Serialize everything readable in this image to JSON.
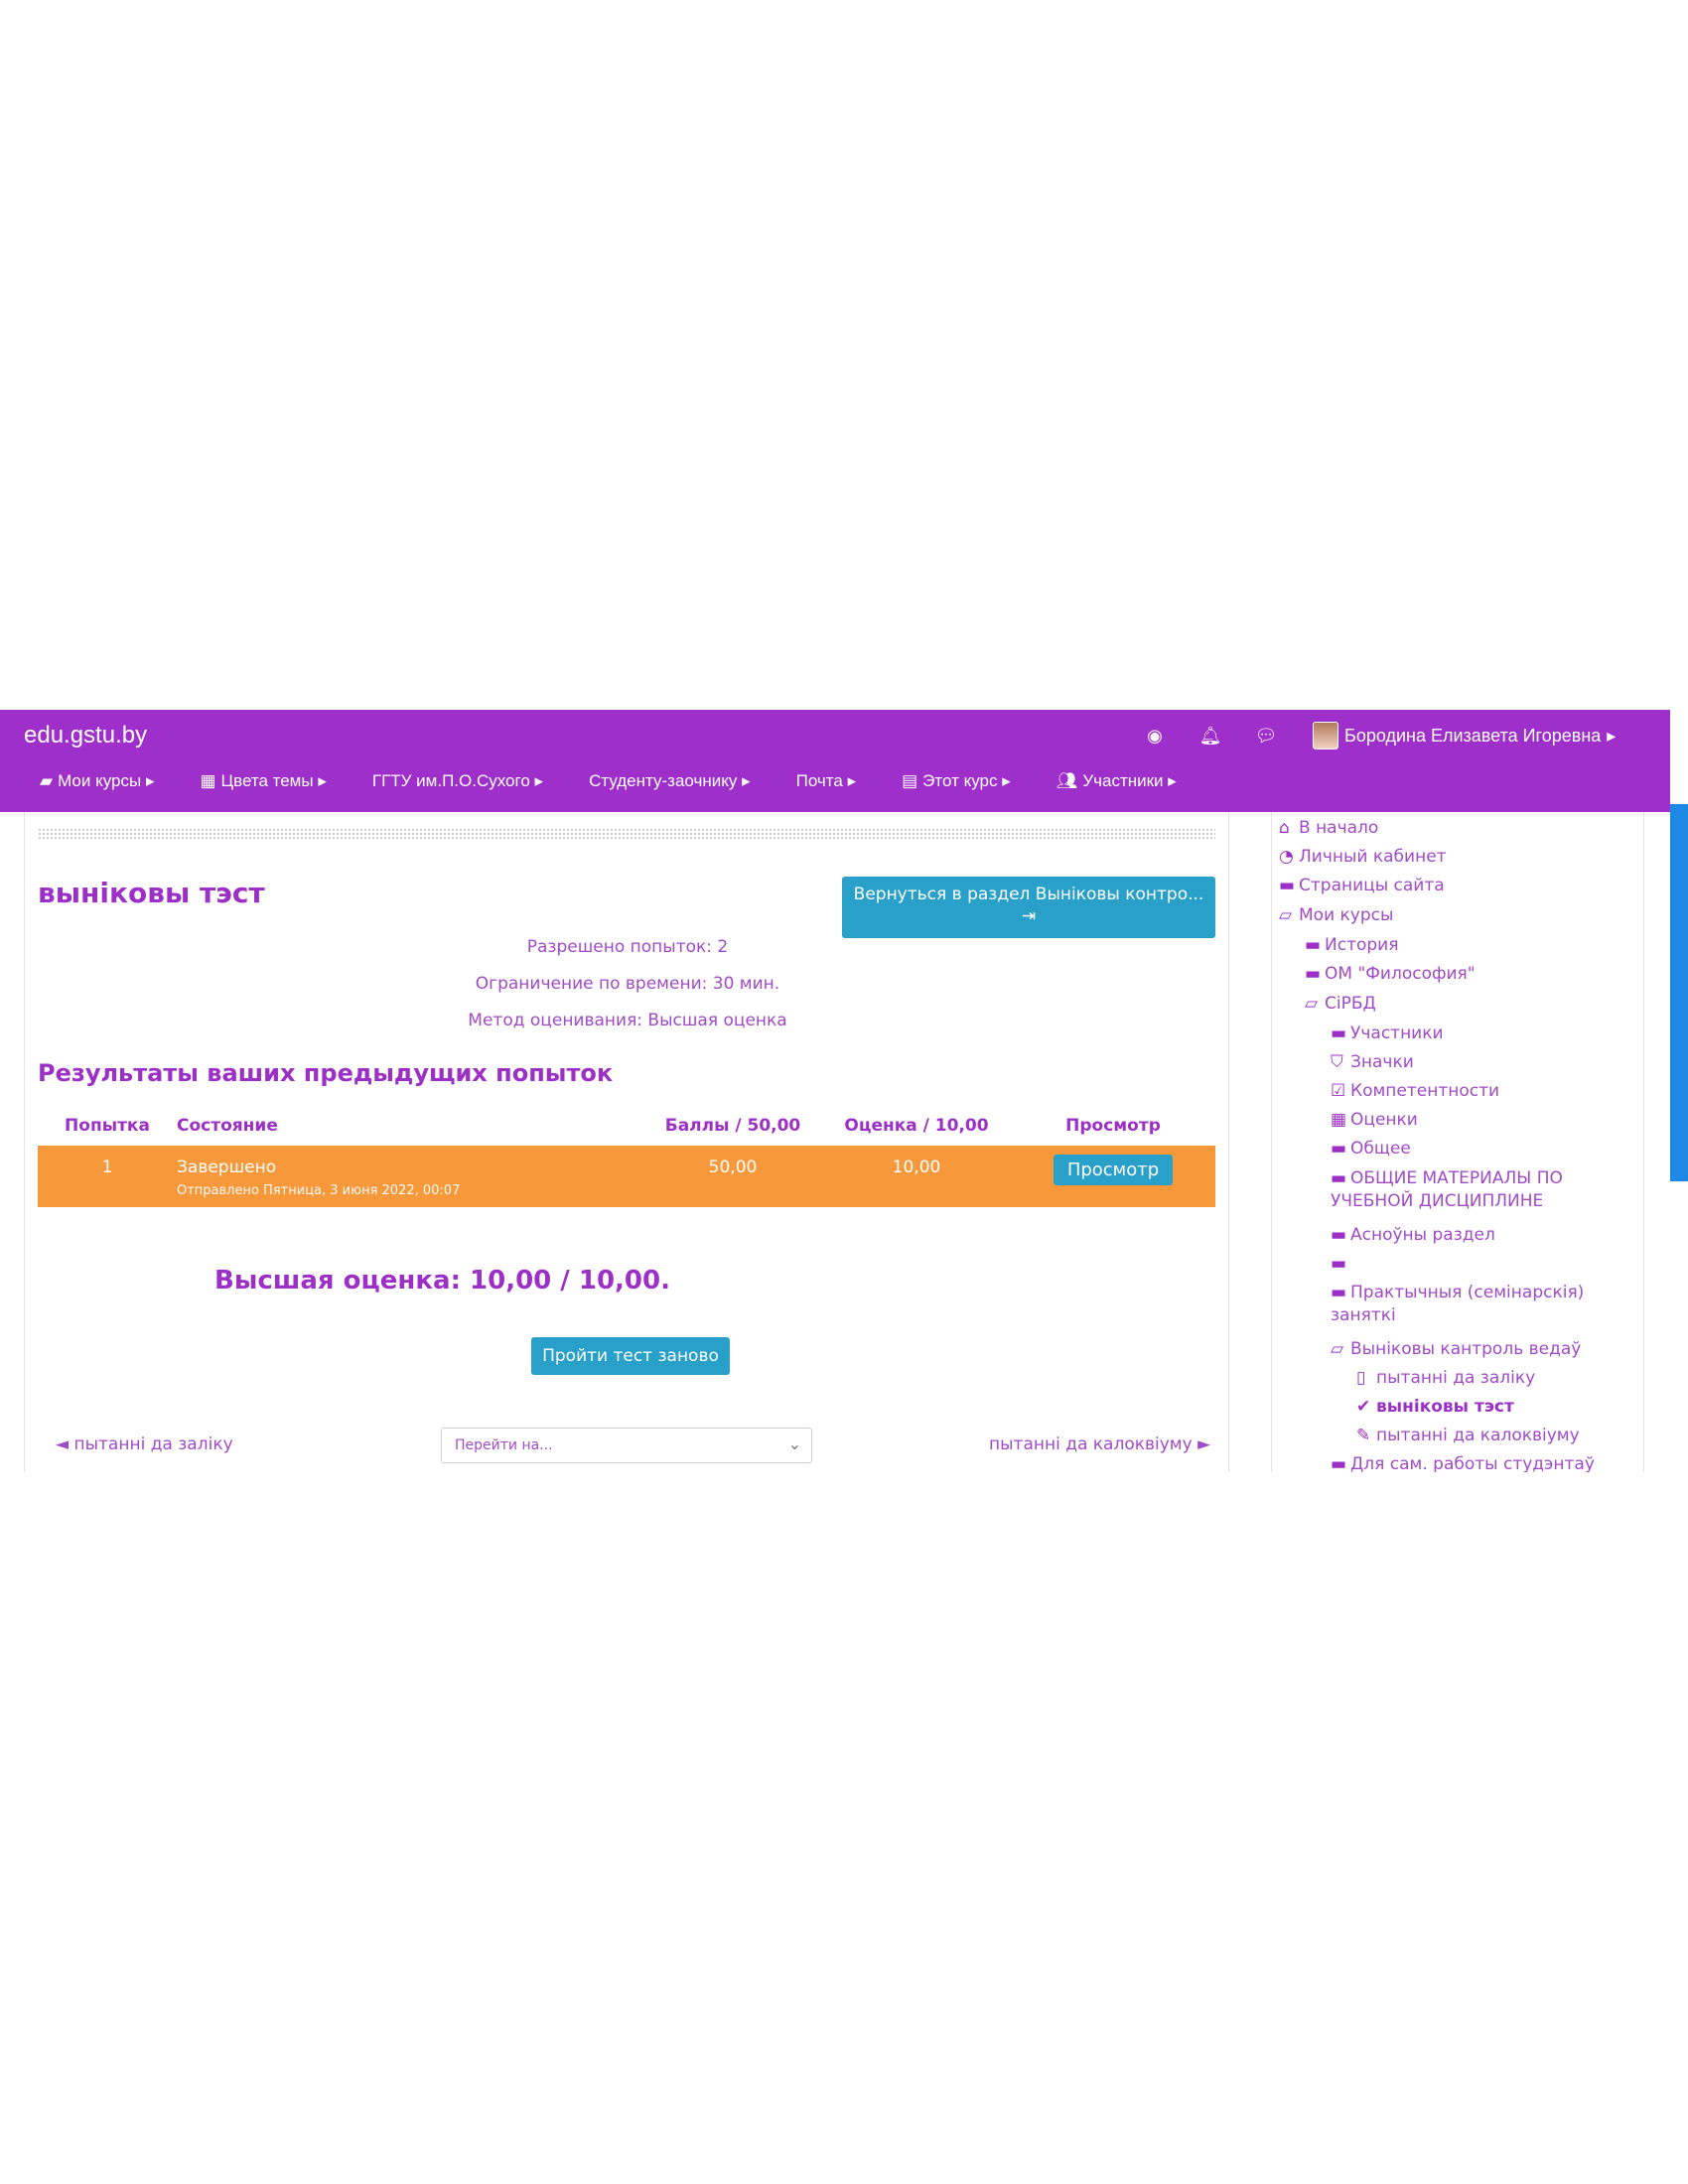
{
  "site": {
    "name": "edu.gstu.by"
  },
  "header": {
    "icons": [
      "target-icon",
      "bell-icon",
      "chat-icon"
    ],
    "user_name": "Бородина Елизавета Игоревна"
  },
  "menu": [
    {
      "label": "Мои курсы",
      "icon": "briefcase-icon"
    },
    {
      "label": "Цвета темы",
      "icon": "grid-icon"
    },
    {
      "label": "ГГТУ им.П.О.Сухого",
      "icon": ""
    },
    {
      "label": "Студенту-заочнику",
      "icon": ""
    },
    {
      "label": "Почта",
      "icon": ""
    },
    {
      "label": "Этот курс",
      "icon": "book-icon"
    },
    {
      "label": "Участники",
      "icon": "users-icon"
    }
  ],
  "main": {
    "quiz_title": "выніковы тэст",
    "back_button": "Вернуться в раздел Выніковы контро...",
    "info": {
      "attempts": "Разрешено попыток: 2",
      "time_limit": "Ограничение по времени: 30 мин.",
      "grading": "Метод оценивания: Высшая оценка"
    },
    "results_heading": "Результаты ваших предыдущих попыток",
    "table": {
      "headers": [
        "Попытка",
        "Состояние",
        "Баллы / 50,00",
        "Оценка / 10,00",
        "Просмотр"
      ],
      "rows": [
        {
          "attempt": "1",
          "state": "Завершено",
          "submitted": "Отправлено Пятница, 3 июня 2022, 00:07",
          "marks": "50,00",
          "grade": "10,00",
          "view": "Просмотр"
        }
      ]
    },
    "highest_grade": "Высшая оценка: 10,00 / 10,00.",
    "retake_button": "Пройти тест заново",
    "prev_link": "◄ пытанні да заліку",
    "jump_placeholder": "Перейти на...",
    "next_link": "пытанні да калоквіуму ►"
  },
  "sidebar": {
    "items": [
      {
        "label": "В начало",
        "icon": "home-icon"
      },
      {
        "label": "Личный кабинет",
        "icon": "dashboard-icon"
      },
      {
        "label": "Страницы сайта",
        "icon": "folder-icon"
      },
      {
        "label": "Мои курсы",
        "icon": "folder-open-icon"
      },
      {
        "label": "История",
        "icon": "folder-icon"
      },
      {
        "label": "ОМ \"Философия\"",
        "icon": "folder-icon"
      },
      {
        "label": "СіРБД",
        "icon": "folder-open-icon"
      },
      {
        "label": "Участники",
        "icon": "folder-icon"
      },
      {
        "label": "Значки",
        "icon": "shield-icon"
      },
      {
        "label": "Компетентности",
        "icon": "checkbox-icon"
      },
      {
        "label": "Оценки",
        "icon": "table-icon"
      },
      {
        "label": "Общее",
        "icon": "folder-icon"
      },
      {
        "label": "ОБЩИЕ МАТЕРИАЛЫ ПО",
        "label2": "УЧЕБНОЙ ДИСЦИПЛИНЕ",
        "icon": "folder-icon"
      },
      {
        "label": "Асноўны раздел",
        "icon": "folder-icon"
      },
      {
        "label": "",
        "icon": "folder-icon"
      },
      {
        "label": "Практычныя (семінарскія)",
        "label2": "заняткі",
        "icon": "folder-icon"
      },
      {
        "label": "Выніковы кантроль ведаў",
        "icon": "folder-open-icon"
      },
      {
        "label": "пытанні да заліку",
        "icon": "page-icon"
      },
      {
        "label": "выніковы тэст",
        "icon": "quiz-icon"
      },
      {
        "label": "пытанні да калоквіуму",
        "icon": "quiz-icon"
      },
      {
        "label": "Для сам. работы студэнтаў",
        "icon": "folder-icon"
      }
    ]
  }
}
